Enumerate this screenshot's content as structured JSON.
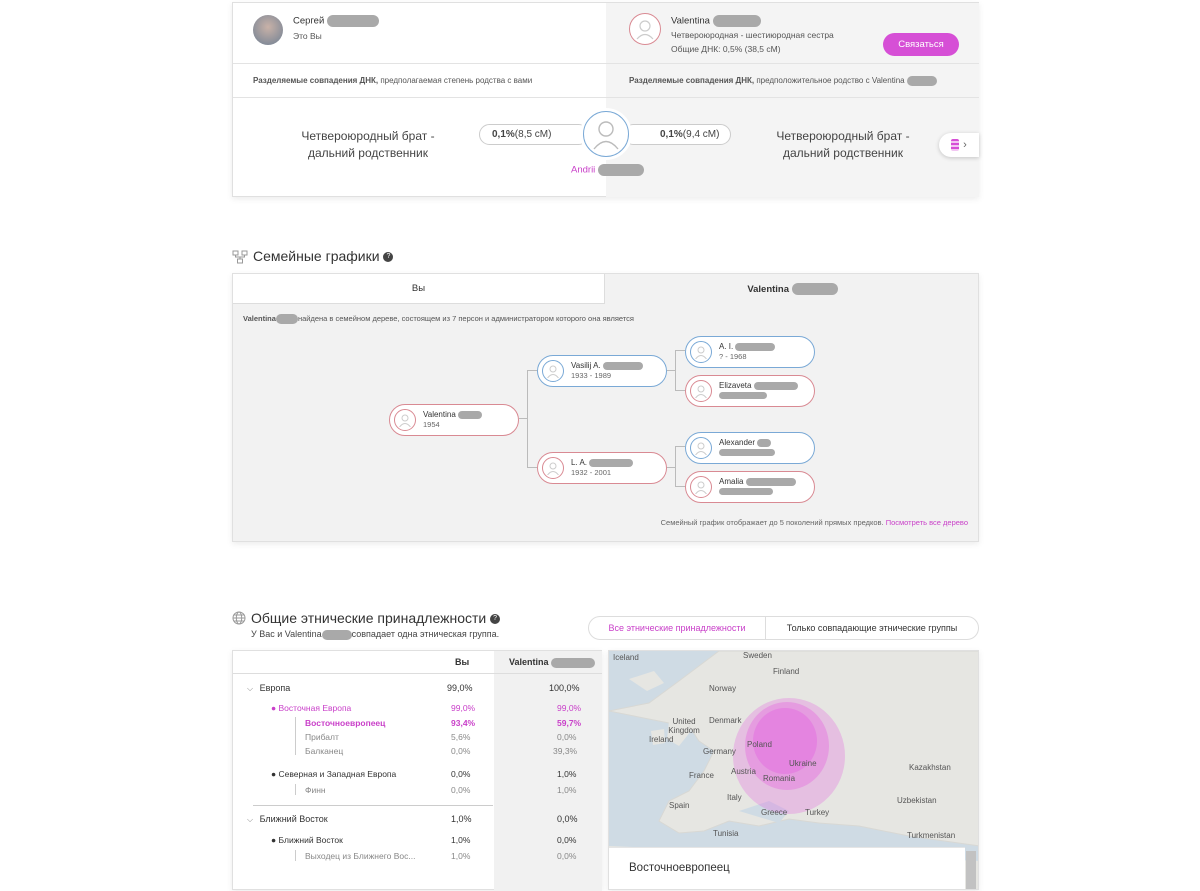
{
  "match": {
    "you": {
      "name": "Сергей",
      "subtitle": "Это Вы"
    },
    "other": {
      "name": "Valentina",
      "relation": "Четвероюродная - шестиюродная сестра",
      "dna_label": "Общие ДНК:",
      "dna_value": "0,5% (38,5 сМ)",
      "contact_button": "Связаться"
    },
    "left_caption": {
      "bold": "Разделяемые совпадения ДНК,",
      "rest": " предполагаемая степень родства с вами"
    },
    "right_caption": {
      "bold": "Разделяемые совпадения ДНК,",
      "rest": " предположительное родство с Valentina"
    },
    "shared": {
      "left_relation_line1": "Четвероюродный брат -",
      "left_relation_line2": "дальний родственник",
      "right_relation_line1": "Четвероюродный брат -",
      "right_relation_line2": "дальний родственник",
      "left_pill_bold": "0,1%",
      "left_pill_rest": " (8,5 сМ)",
      "right_pill_bold": "0,1%",
      "right_pill_rest": " (9,4 сМ)",
      "person_name": "Andrii"
    }
  },
  "family": {
    "title": "Семейные графики",
    "tab_you": "Вы",
    "tab_other": "Valentina",
    "info_bold": "Valentina",
    "info_rest": "найдена в семейном дереве, состоящем из 7 персон и администратором которого она является",
    "nodes": {
      "root": {
        "name": "Valentina",
        "years": "1954"
      },
      "father": {
        "name": "Vasilij A.",
        "years": "1933 - 1989"
      },
      "mother": {
        "name": "L. A.",
        "years": "1932 - 2001"
      },
      "pgf": {
        "name": "A. I.",
        "years": "? - 1968"
      },
      "pgm": {
        "name": "Elizaveta",
        "years": ""
      },
      "mgf": {
        "name": "Alexander",
        "years": ""
      },
      "mgm": {
        "name": "Amalia",
        "years": ""
      }
    },
    "footer_text": "Семейный график отображает до 5 поколений прямых предков.",
    "footer_link": "Посмотреть все дерево"
  },
  "ethnic": {
    "title": "Общие этнические принадлежности",
    "subtitle_start": "У Вас и Valentina",
    "subtitle_end": "совпадает одна этническая группа.",
    "filter_all": "Все этнические принадлежности",
    "filter_matching": "Только совпадающие этнические группы",
    "col_you": "Вы",
    "col_other": "Valentina",
    "rows": [
      {
        "label": "Европа",
        "you": "99,0%",
        "other": "100,0%"
      },
      {
        "label": "Восточная Европа",
        "you": "99,0%",
        "other": "99,0%"
      },
      {
        "label": "Восточноевропеец",
        "you": "93,4%",
        "other": "59,7%"
      },
      {
        "label": "Прибалт",
        "you": "5,6%",
        "other": "0,0%"
      },
      {
        "label": "Балканец",
        "you": "0,0%",
        "other": "39,3%"
      },
      {
        "label": "Северная и Западная Европа",
        "you": "0,0%",
        "other": "1,0%"
      },
      {
        "label": "Финн",
        "you": "0,0%",
        "other": "1,0%"
      },
      {
        "label": "Ближний Восток",
        "you": "1,0%",
        "other": "0,0%"
      },
      {
        "label": "Ближний Восток",
        "you": "1,0%",
        "other": "0,0%"
      },
      {
        "label": "Выходец из Ближнего Вос...",
        "you": "1,0%",
        "other": "0,0%"
      }
    ],
    "map_labels": [
      "Iceland",
      "Sweden",
      "Finland",
      "Norway",
      "Denmark",
      "United Kingdom",
      "Ireland",
      "Germany",
      "Poland",
      "Ukraine",
      "France",
      "Austria",
      "Romania",
      "Kazakhstan",
      "Uzbekistan",
      "Spain",
      "Italy",
      "Greece",
      "Turkey",
      "Tunisia",
      "Turkmenistan"
    ],
    "map_panel_title": "Восточноевропеец"
  },
  "colors": {
    "accent": "#c940c9",
    "magenta_button": "#d64fd6",
    "blue_border": "#7aa9d6",
    "red_border": "#d98a93"
  }
}
